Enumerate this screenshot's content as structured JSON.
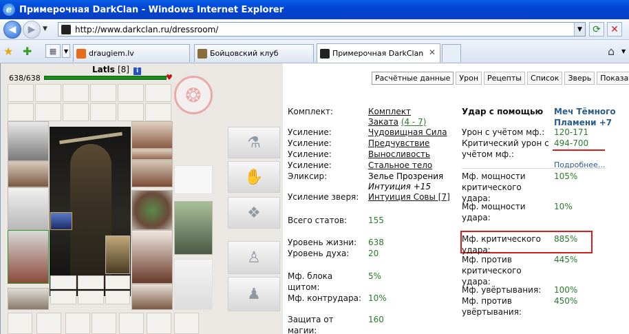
{
  "window": {
    "title": "Примерочная DarkClan - Windows Internet Explorer"
  },
  "address": {
    "url": "http://www.darkclan.ru/dressroom/"
  },
  "tabs": [
    {
      "label": "draugiem.lv"
    },
    {
      "label": "Бойцовский клуб"
    },
    {
      "label": "Примерочная DarkClan"
    }
  ],
  "character": {
    "name": "Latls",
    "level": "[8]",
    "info": "i",
    "hp": "638/638",
    "hp_fraction": 1.0
  },
  "right_tabs": [
    "Расчётные данные",
    "Урон",
    "Рецепты",
    "Список",
    "Зверь",
    "Показатели"
  ],
  "stats": {
    "set_label": "Комплект:",
    "set_value": "Комплект Заката",
    "set_value_line1": "Комплект",
    "set_value_line2": "Заката",
    "set_count": "(4 - 7)",
    "boost1_label": "Усиление:",
    "boost1_value": "Чудовищная Сила",
    "boost2_label": "Усиление:",
    "boost2_value": "Предчувствие",
    "boost3_label": "Усиление:",
    "boost3_value": "Выносливость",
    "boost4_label": "Усиление:",
    "boost4_value": "Стальное тело",
    "elixir_label": "Эликсир:",
    "elixir_value": "Зелье Прозрения",
    "elixir_effect": "Интуиция +15",
    "beast_label": "Усиление зверя:",
    "beast_value": "Интуиция Совы [7]",
    "total_label": "Всего статов:",
    "total_value": "155",
    "life_label": "Уровень жизни:",
    "life_value": "638",
    "spirit_label": "Уровень духа:",
    "spirit_value": "20",
    "block_label": "Мф. блока щитом:",
    "block_value": "5%",
    "counter_label": "Мф. контрудара:",
    "counter_value": "10%",
    "magic_label": "Защита от магии:",
    "magic_value": "160"
  },
  "combat": {
    "strike_label": "Удар с помощью",
    "weapon": "Меч Тёмного Пламени +7",
    "damage_label": "Урон с учётом мф.:",
    "damage_value": "120-171",
    "crit_label": "Критический урон с учётом мф.:",
    "crit_value": "494-700",
    "more_link": "Подробнее...",
    "power_crit_label": "Мф. мощности критического удара:",
    "power_crit_value": "105%",
    "power_label": "Мф. мощности удара:",
    "power_value": "10%",
    "crit_mf_label": "Мф. критического удара:",
    "crit_mf_value": "885%",
    "anticrit_label": "Мф. против критического удара:",
    "anticrit_value": "445%",
    "dodge_label": "Мф. увёртывания:",
    "dodge_value": "100%",
    "antidodge_label": "Мф. против увёртывания:",
    "antidodge_value": "450%"
  }
}
